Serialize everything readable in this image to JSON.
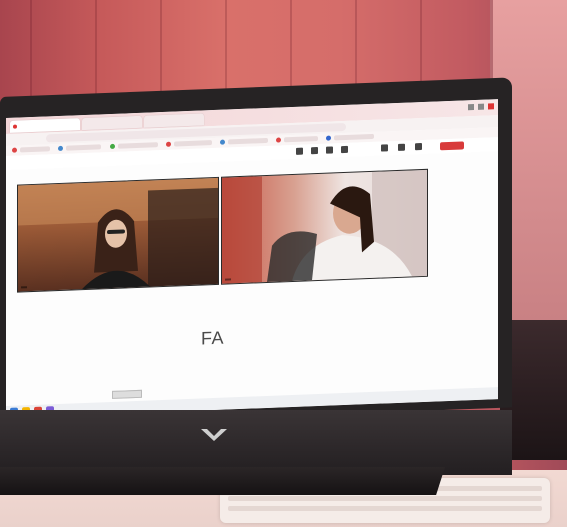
{
  "meeting": {
    "participants": [
      {
        "label": "",
        "role": "participant"
      },
      {
        "label": "",
        "role": "participant"
      }
    ],
    "main_text": "FA",
    "leave_button": ""
  },
  "colors": {
    "wall": "#c65a5a",
    "bezel": "#262324",
    "leave": "#d83a3a",
    "screen_bg": "#fdfdfd"
  },
  "icons": [
    "hp-logo-icon",
    "camera-icon",
    "mic-icon",
    "share-screen-icon",
    "leave-icon",
    "windows-start-icon"
  ]
}
